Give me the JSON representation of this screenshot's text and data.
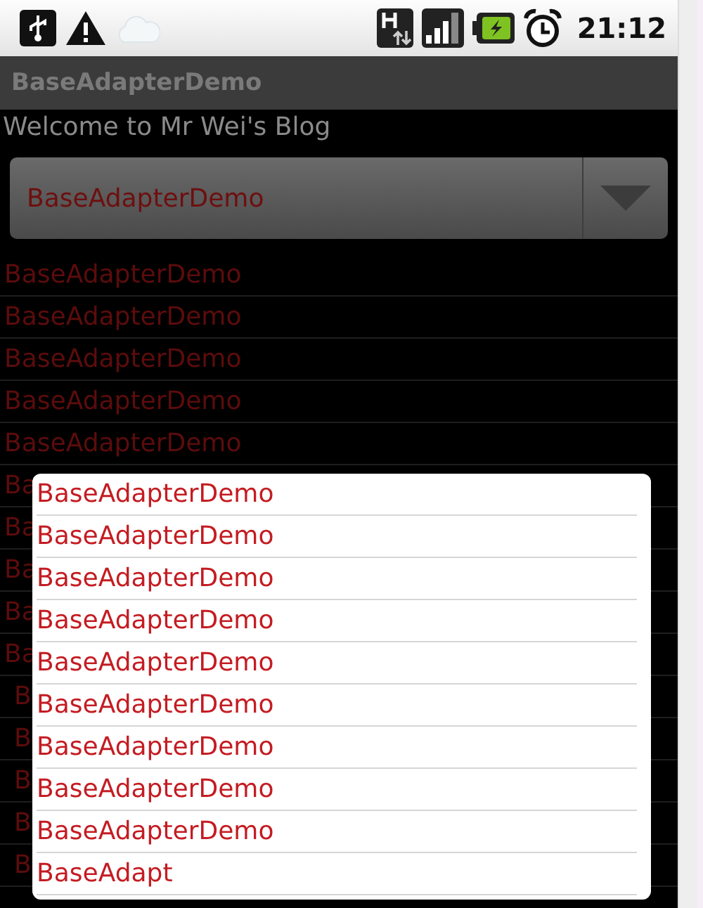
{
  "status_bar": {
    "time": "21:12"
  },
  "title_bar": {
    "title": "BaseAdapterDemo"
  },
  "welcome": "Welcome to Mr Wei's Blog",
  "spinner": {
    "value": "BaseAdapterDemo"
  },
  "list": [
    {
      "text": "BaseAdapterDemo",
      "indented": false
    },
    {
      "text": "BaseAdapterDemo",
      "indented": false
    },
    {
      "text": "BaseAdapterDemo",
      "indented": false
    },
    {
      "text": "BaseAdapterDemo",
      "indented": false
    },
    {
      "text": "BaseAdapterDemo",
      "indented": false
    },
    {
      "text": "Ba",
      "indented": false
    },
    {
      "text": "Ba",
      "indented": false
    },
    {
      "text": "Ba",
      "indented": false
    },
    {
      "text": "Ba",
      "indented": false
    },
    {
      "text": "Ba",
      "indented": false
    },
    {
      "text": "B",
      "indented": true
    },
    {
      "text": "B",
      "indented": true
    },
    {
      "text": "B",
      "indented": true
    },
    {
      "text": "B",
      "indented": true
    },
    {
      "text": "B",
      "indented": true
    }
  ],
  "dropdown": {
    "items": [
      "BaseAdapterDemo",
      "BaseAdapterDemo",
      "BaseAdapterDemo",
      "BaseAdapterDemo",
      "BaseAdapterDemo",
      "BaseAdapterDemo",
      "BaseAdapterDemo",
      "BaseAdapterDemo",
      "BaseAdapterDemo",
      "BaseAdapt"
    ]
  }
}
